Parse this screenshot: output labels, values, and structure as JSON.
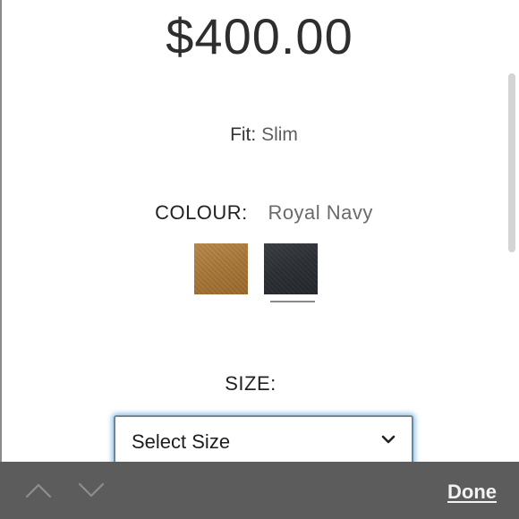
{
  "product": {
    "price": "$400.00",
    "fit_label": "Fit:",
    "fit_value": "Slim"
  },
  "colour": {
    "label": "COLOUR:",
    "selected": "Royal Navy",
    "swatches": [
      {
        "name": "tan",
        "color": "#a77637",
        "selected": false
      },
      {
        "name": "royal-navy",
        "color": "#2b2e33",
        "selected": true
      }
    ]
  },
  "size": {
    "label": "SIZE:",
    "select_value": "Select Size",
    "focus_ring_color": "#6eaadc"
  },
  "keyboard_toolbar": {
    "previous_icon": "chevron-up-icon",
    "next_icon": "chevron-down-icon",
    "done_label": "Done",
    "background": "#5c5c5c"
  }
}
